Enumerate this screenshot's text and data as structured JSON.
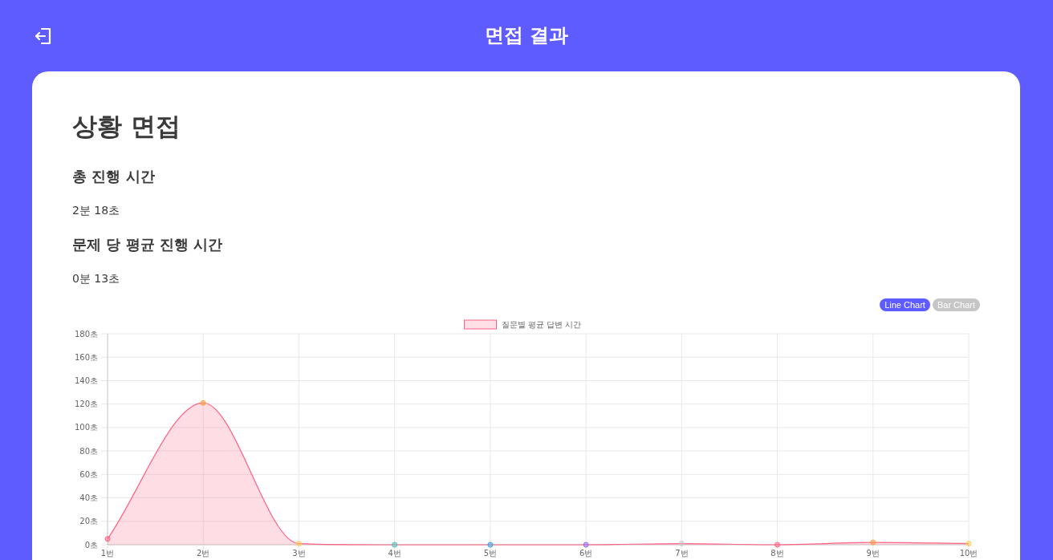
{
  "header": {
    "title": "면접 결과"
  },
  "content": {
    "title": "상황 면접",
    "stats": [
      {
        "label": "총 진행 시간",
        "value": "2분 18초"
      },
      {
        "label": "문제 당 평균 진행 시간",
        "value": "0분 13초"
      }
    ]
  },
  "chart_toggle": [
    {
      "label": "Line Chart",
      "selected": true
    },
    {
      "label": "Bar Chart",
      "selected": false
    }
  ],
  "chart_data": {
    "type": "area",
    "grid": true,
    "categories": [
      "1번",
      "2번",
      "3번",
      "4번",
      "5번",
      "6번",
      "7번",
      "8번",
      "9번",
      "10번"
    ],
    "series": [
      {
        "name": "질문별 평균 답변 시간",
        "color": "#ff6384",
        "values": [
          5,
          121,
          1,
          0,
          0,
          0,
          1,
          0,
          2,
          1
        ]
      }
    ],
    "ylim": [
      0,
      180
    ],
    "yticks": [
      {
        "value": 0,
        "label": "0초"
      },
      {
        "value": 20,
        "label": "20초"
      },
      {
        "value": 40,
        "label": "40초"
      },
      {
        "value": 60,
        "label": "60초"
      },
      {
        "value": 80,
        "label": "80초"
      },
      {
        "value": 100,
        "label": "100초"
      },
      {
        "value": 120,
        "label": "120초"
      },
      {
        "value": 140,
        "label": "140초"
      },
      {
        "value": 160,
        "label": "160초"
      },
      {
        "value": 180,
        "label": "180초"
      }
    ]
  }
}
